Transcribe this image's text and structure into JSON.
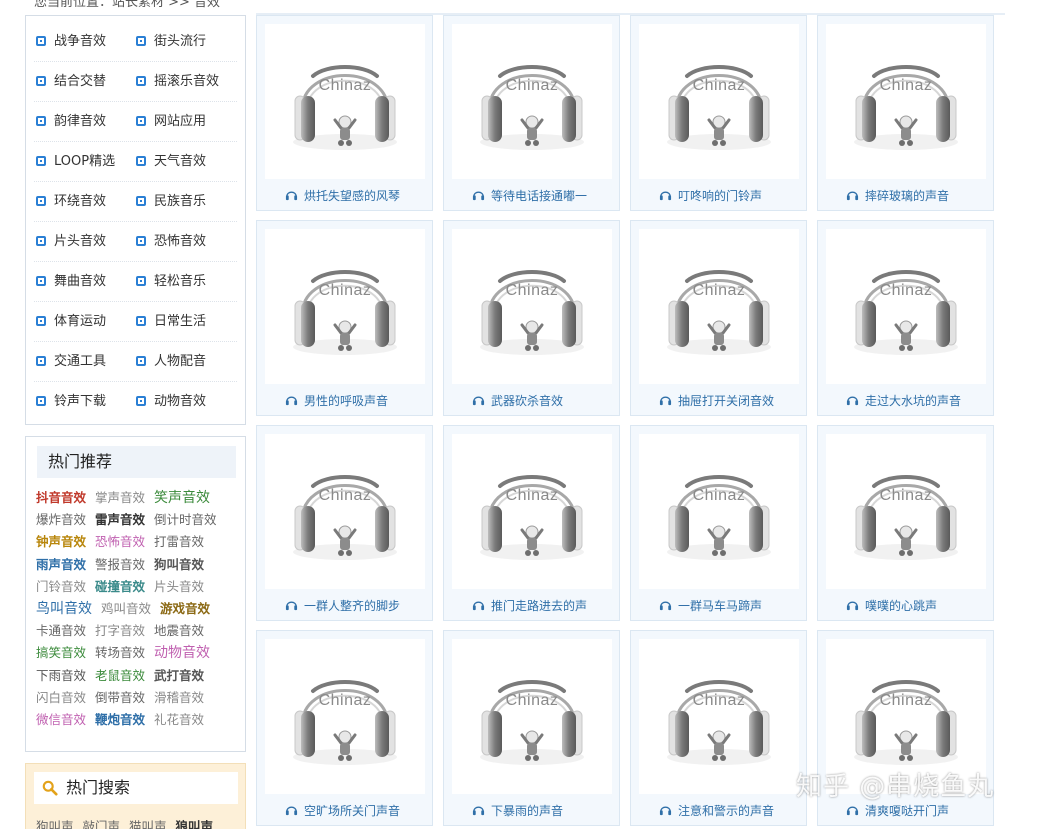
{
  "breadcrumb": "您当前位置：站长素材 >> 音效",
  "categories": [
    [
      "战争音效",
      "街头流行"
    ],
    [
      "结合交替",
      "摇滚乐音效"
    ],
    [
      "韵律音效",
      "网站应用"
    ],
    [
      "LOOP精选",
      "天气音效"
    ],
    [
      "环绕音效",
      "民族音乐"
    ],
    [
      "片头音效",
      "恐怖音效"
    ],
    [
      "舞曲音效",
      "轻松音乐"
    ],
    [
      "体育运动",
      "日常生活"
    ],
    [
      "交通工具",
      "人物配音"
    ],
    [
      "铃声下载",
      "动物音效"
    ]
  ],
  "hot_recommend": {
    "title": "热门推荐",
    "rows": [
      [
        {
          "t": "抖音音效",
          "c": "#c0392b",
          "b": true
        },
        {
          "t": "掌声音效",
          "c": "#888"
        },
        {
          "t": "笑声音效",
          "c": "#3a8a3a",
          "big": true
        }
      ],
      [
        {
          "t": "爆炸音效",
          "c": "#666"
        },
        {
          "t": "雷声音效",
          "c": "#333",
          "b": true
        },
        {
          "t": "倒计时音效",
          "c": "#666"
        }
      ],
      [
        {
          "t": "钟声音效",
          "c": "#b8860b",
          "b": true
        },
        {
          "t": "恐怖音效",
          "c": "#c060b0"
        },
        {
          "t": "打雷音效",
          "c": "#666"
        }
      ],
      [
        {
          "t": "雨声音效",
          "c": "#2f6fa8",
          "b": true
        },
        {
          "t": "警报音效",
          "c": "#666"
        },
        {
          "t": "狗叫音效",
          "c": "#555",
          "b": true
        }
      ],
      [
        {
          "t": "门铃音效",
          "c": "#888"
        },
        {
          "t": "碰撞音效",
          "c": "#3a8a8a",
          "b": true
        },
        {
          "t": "片头音效",
          "c": "#888"
        }
      ],
      [
        {
          "t": "鸟叫音效",
          "c": "#2f6fa8",
          "big": true
        },
        {
          "t": "鸡叫音效",
          "c": "#888"
        },
        {
          "t": "游戏音效",
          "c": "#8b6914",
          "b": true
        }
      ],
      [
        {
          "t": "卡通音效",
          "c": "#666"
        },
        {
          "t": "打字音效",
          "c": "#888"
        },
        {
          "t": "地震音效",
          "c": "#666"
        }
      ],
      [
        {
          "t": "搞笑音效",
          "c": "#3a8a3a"
        },
        {
          "t": "转场音效",
          "c": "#666"
        },
        {
          "t": "动物音效",
          "c": "#c060b0",
          "big": true
        }
      ],
      [
        {
          "t": "下雨音效",
          "c": "#555"
        },
        {
          "t": "老鼠音效",
          "c": "#3a8a3a"
        },
        {
          "t": "武打音效",
          "c": "#555",
          "b": true
        }
      ],
      [
        {
          "t": "闪白音效",
          "c": "#888"
        },
        {
          "t": "倒带音效",
          "c": "#666"
        },
        {
          "t": "滑稽音效",
          "c": "#888"
        }
      ],
      [
        {
          "t": "微信音效",
          "c": "#c060b0"
        },
        {
          "t": "鞭炮音效",
          "c": "#2f6fa8",
          "b": true
        },
        {
          "t": "礼花音效",
          "c": "#888"
        }
      ]
    ]
  },
  "hot_search": {
    "title": "热门搜索",
    "items": [
      "狗叫声",
      "敲门声",
      "猫叫声",
      "狼叫声"
    ]
  },
  "thumb_label": "Chinaz",
  "sounds": [
    "烘托失望感的风琴",
    "等待电话接通嘟一",
    "叮咚响的门铃声",
    "摔碎玻璃的声音",
    "男性的呼吸声音",
    "武器砍杀音效",
    "抽屉打开关闭音效",
    "走过大水坑的声音",
    "一群人整齐的脚步",
    "推门走路进去的声",
    "一群马车马蹄声",
    "噗噗的心跳声",
    "空旷场所关门声音",
    "下暴雨的声音",
    "注意和警示的声音",
    "清爽嗄哒开门声"
  ],
  "watermark": "知乎 @串烧鱼丸",
  "colors": {
    "accent": "#2a7fd4",
    "caption": "#2f6fa8",
    "card_bg": "#f3f8fd",
    "search_bg": "#fdf0d8"
  }
}
